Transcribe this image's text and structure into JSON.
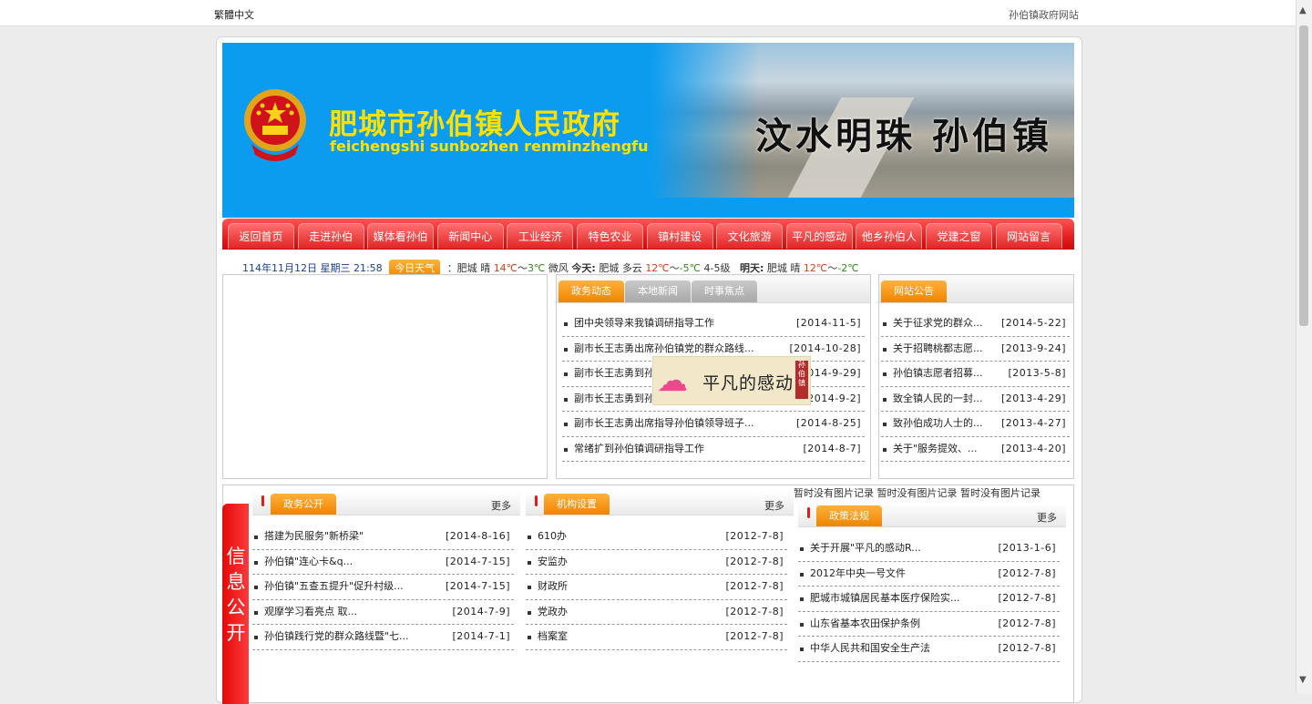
{
  "topbar": {
    "traditional": "繁體中文",
    "site_name": "孙伯镇政府网站"
  },
  "banner": {
    "title": "肥城市孙伯镇人民政府",
    "pinyin": "feichengshi sunbozhen renminzhengfu",
    "slogan": "汶水明珠 孙伯镇"
  },
  "nav": [
    "返回首页",
    "走进孙伯",
    "媒体看孙伯",
    "新闻中心",
    "工业经济",
    "特色农业",
    "镇村建设",
    "文化旅游",
    "平凡的感动",
    "他乡孙伯人",
    "党建之窗",
    "网站留言"
  ],
  "weather": {
    "datetime": "114年11月12日 星期三 21:58",
    "tag": "今日天气",
    "city": "：肥城",
    "now_cond": "晴",
    "now_hi": "14℃",
    "sep1": "～",
    "now_lo": "3℃",
    "wind": "微风",
    "today_label": "今天:",
    "today_city": "肥城",
    "today_cond": "多云",
    "today_hi": "12℃",
    "sep2": "～",
    "today_lo": "-5℃",
    "today_wind": "4-5级",
    "tomorrow_label": "明天:",
    "tomorrow_city": "肥城",
    "tomorrow_cond": "晴",
    "tomorrow_hi": "12℃",
    "sep3": "～",
    "tomorrow_lo": "-2℃"
  },
  "news": {
    "tabs": [
      "政务动态",
      "本地新闻",
      "时事焦点"
    ],
    "items": [
      {
        "title": "团中央领导来我镇调研指导工作",
        "date": "[2014-11-5]"
      },
      {
        "title": "副市长王志勇出席孙伯镇党的群众路线...",
        "date": "[2014-10-28]"
      },
      {
        "title": "副市长王志勇到孙",
        "date": "[2014-9-29]"
      },
      {
        "title": "副市长王志勇到孙",
        "date": "[2014-9-2]"
      },
      {
        "title": "副市长王志勇出席指导孙伯镇领导班子...",
        "date": "[2014-8-25]"
      },
      {
        "title": "常绪扩到孙伯镇调研指导工作",
        "date": "[2014-8-7]"
      }
    ]
  },
  "notice": {
    "tab": "网站公告",
    "items": [
      {
        "title": "关于征求党的群众...",
        "date": "[2014-5-22]"
      },
      {
        "title": "关于招聘桃都志愿...",
        "date": "[2013-9-24]"
      },
      {
        "title": "孙伯镇志愿者招募...",
        "date": "[2013-5-8]"
      },
      {
        "title": "致全镇人民的一封...",
        "date": "[2013-4-29]"
      },
      {
        "title": "致孙伯成功人士的...",
        "date": "[2013-4-27]"
      },
      {
        "title": "关于\"服务提效、...",
        "date": "[2013-4-20]"
      }
    ]
  },
  "popup": {
    "text": "平凡的感动",
    "seal": "孙伯镇"
  },
  "info": {
    "side_label": "信息公开",
    "no_image": "暂时没有图片记录 暂时没有图片记录 暂时没有图片记录",
    "more": "更多",
    "gov": {
      "tab": "政务公开",
      "items": [
        {
          "title": "搭建为民服务\"新桥梁\"",
          "date": "[2014-8-16]"
        },
        {
          "title": "孙伯镇\"连心卡&q...",
          "date": "[2014-7-15]"
        },
        {
          "title": "孙伯镇\"五查五提升\"促升村级...",
          "date": "[2014-7-15]"
        },
        {
          "title": "观摩学习看亮点 取...",
          "date": "[2014-7-9]"
        },
        {
          "title": "孙伯镇践行党的群众路线暨\"七...",
          "date": "[2014-7-1]"
        }
      ]
    },
    "org": {
      "tab": "机构设置",
      "items": [
        {
          "title": "610办",
          "date": "[2012-7-8]"
        },
        {
          "title": "安监办",
          "date": "[2012-7-8]"
        },
        {
          "title": "财政所",
          "date": "[2012-7-8]"
        },
        {
          "title": "党政办",
          "date": "[2012-7-8]"
        },
        {
          "title": "档案室",
          "date": "[2012-7-8]"
        }
      ]
    },
    "policy": {
      "tab": "政策法规",
      "items": [
        {
          "title": "关于开展\"平凡的感动R...",
          "date": "[2013-1-6]"
        },
        {
          "title": "2012年中央一号文件",
          "date": "[2012-7-8]"
        },
        {
          "title": "肥城市城镇居民基本医疗保险实...",
          "date": "[2012-7-8]"
        },
        {
          "title": "山东省基本农田保护条例",
          "date": "[2012-7-8]"
        },
        {
          "title": "中华人民共和国安全生产法",
          "date": "[2012-7-8]"
        }
      ]
    }
  }
}
